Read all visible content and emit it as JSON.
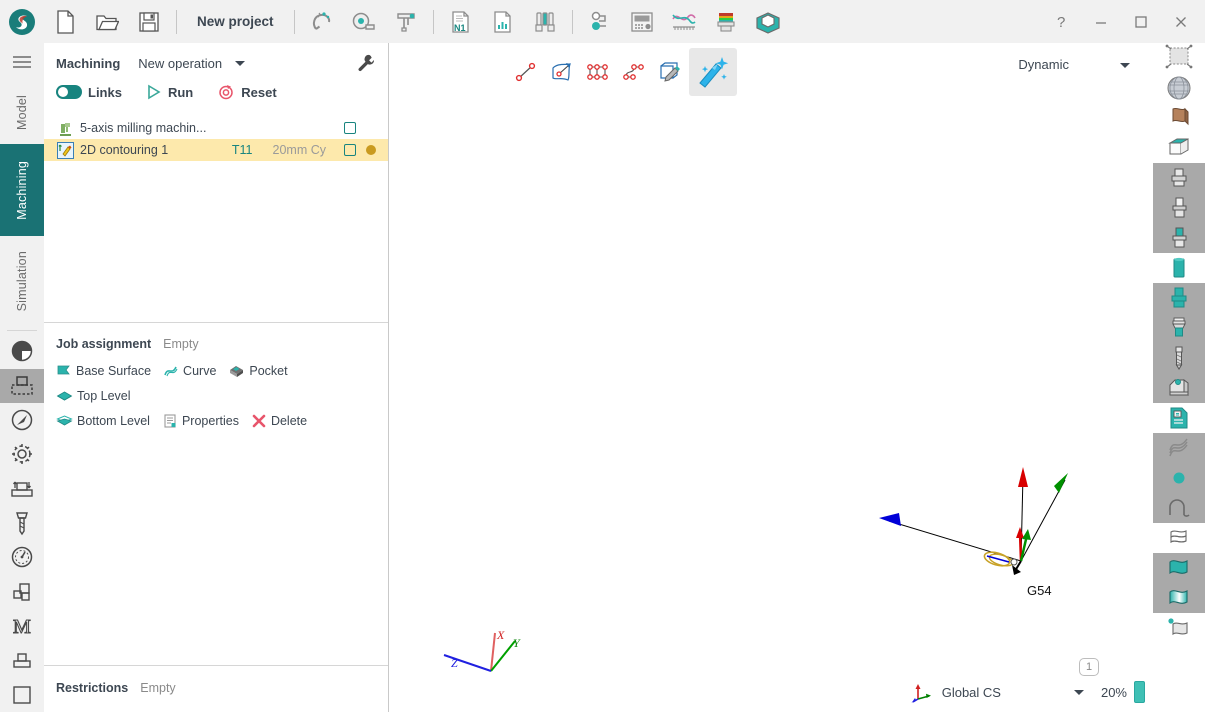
{
  "window": {
    "title": "New project",
    "controls": [
      {
        "name": "help-button",
        "glyph": "?"
      },
      {
        "name": "minimize-button",
        "glyph": "—"
      },
      {
        "name": "maximize-button",
        "glyph": "□"
      },
      {
        "name": "close-button",
        "glyph": "✕"
      }
    ]
  },
  "toolbar": {
    "file_icons": [
      "new-document-icon",
      "open-folder-icon",
      "save-disk-icon"
    ],
    "tool_icons": [
      "magnet-icon",
      "measure-tape-icon",
      "caliper-icon",
      "nc-program-icon",
      "report-chart-icon",
      "tool-library-icon",
      "post-processor-icon",
      "control-panel-icon",
      "feed-curve-icon",
      "stock-color-icon",
      "fixture-box-icon"
    ]
  },
  "rail": {
    "menu_icon": "hamburger-icon",
    "tabs": [
      {
        "label": "Model",
        "active": false
      },
      {
        "label": "Machining",
        "active": true
      },
      {
        "label": "Simulation",
        "active": false
      }
    ],
    "icons": [
      {
        "name": "shading-sphere-icon",
        "selected": false
      },
      {
        "name": "stock-workpiece-icon",
        "selected": true
      },
      {
        "name": "compass-orientation-icon",
        "selected": false
      },
      {
        "name": "settings-gear-icon",
        "selected": false
      },
      {
        "name": "clearance-levels-icon",
        "selected": false
      },
      {
        "name": "end-mill-tool-icon",
        "selected": false
      },
      {
        "name": "speed-gauge-icon",
        "selected": false
      },
      {
        "name": "layers-stack-icon",
        "selected": false
      },
      {
        "name": "machine-m-icon",
        "selected": false
      },
      {
        "name": "fixture-base-icon",
        "selected": false
      },
      {
        "name": "blank-square-icon",
        "selected": false
      }
    ]
  },
  "machining": {
    "title": "Machining",
    "new_operation_label": "New operation",
    "wrench_icon": "wrench-settings-icon",
    "actions": [
      {
        "name": "links-toggle",
        "label": "Links",
        "icon": "toggle-switch-on-icon"
      },
      {
        "name": "run-button",
        "label": "Run",
        "icon": "play-triangle-icon"
      },
      {
        "name": "reset-button",
        "label": "Reset",
        "icon": "reset-circle-icon"
      }
    ],
    "tree": [
      {
        "name": "machine-node",
        "icon": "milling-machine-icon",
        "label": "5-axis milling machin...",
        "tool": "",
        "tool_desc": "",
        "checkbox": true,
        "status_dot": false,
        "selected": false
      },
      {
        "name": "operation-node",
        "icon": "contouring-op-icon",
        "label": "2D contouring 1",
        "tool": "T11",
        "tool_desc": "20mm Cy",
        "checkbox": true,
        "status_dot": true,
        "selected": true
      }
    ]
  },
  "job_assignment": {
    "title": "Job assignment",
    "value": "Empty",
    "chips": [
      {
        "name": "base-surface-chip",
        "label": "Base Surface",
        "icon": "flag-teal-icon"
      },
      {
        "name": "curve-chip",
        "label": "Curve",
        "icon": "curve-squiggle-icon"
      },
      {
        "name": "pocket-chip",
        "label": "Pocket",
        "icon": "pocket-box-icon"
      },
      {
        "name": "top-level-chip",
        "label": "Top Level",
        "icon": "top-level-diamond-icon"
      },
      {
        "name": "bottom-level-chip",
        "label": "Bottom Level",
        "icon": "bottom-level-diamond-icon"
      },
      {
        "name": "properties-chip",
        "label": "Properties",
        "icon": "properties-list-icon"
      },
      {
        "name": "delete-chip",
        "label": "Delete",
        "icon": "delete-cross-icon"
      }
    ]
  },
  "restrictions": {
    "title": "Restrictions",
    "value": "Empty"
  },
  "viewport": {
    "tools": [
      {
        "name": "line-segment-tool",
        "active": false
      },
      {
        "name": "surface-pick-tool",
        "active": false
      },
      {
        "name": "polyline-tool",
        "active": false
      },
      {
        "name": "spline-tool",
        "active": false
      },
      {
        "name": "edit-geometry-tool",
        "active": false
      },
      {
        "name": "magic-wand-tool",
        "active": true
      }
    ],
    "view_mode": "Dynamic",
    "cs_label": "Global CS",
    "zoom": "20%",
    "page_badge": "1",
    "wcs_label": "G54",
    "axis_labels": {
      "x": "X",
      "y": "Y",
      "z": "Z"
    }
  },
  "right_toolbar": [
    {
      "name": "mesh-surface-icon",
      "gray": false
    },
    {
      "name": "globe-sphere-icon",
      "gray": false
    },
    {
      "name": "brown-flag-icon",
      "gray": false
    },
    {
      "name": "bounding-box-icon",
      "gray": false
    },
    {
      "name": "tool-holder-1-icon",
      "gray": true
    },
    {
      "name": "tool-holder-2-icon",
      "gray": true
    },
    {
      "name": "tool-holder-3-icon",
      "gray": true
    },
    {
      "name": "tool-shank-teal-icon",
      "gray": false
    },
    {
      "name": "tool-body-teal-icon",
      "gray": true
    },
    {
      "name": "tool-stack-icon",
      "gray": true
    },
    {
      "name": "drill-bit-icon",
      "gray": true
    },
    {
      "name": "fixture-clamp-icon",
      "gray": true
    },
    {
      "name": "document-teal-icon",
      "gray": false
    },
    {
      "name": "hatch-pattern-icon",
      "gray": true
    },
    {
      "name": "point-dot-icon",
      "gray": true
    },
    {
      "name": "arc-curve-icon",
      "gray": true
    },
    {
      "name": "wireframe-surface-icon",
      "gray": false
    },
    {
      "name": "surface-teal-icon",
      "gray": true
    },
    {
      "name": "surface-gradient-icon",
      "gray": true
    },
    {
      "name": "flag-point-icon",
      "gray": false
    }
  ],
  "colors": {
    "accent_teal": "#1a7274",
    "toggle_green": "#18847f",
    "selection_amber": "#fde9ac",
    "panel_bg": "#f1f1f1",
    "text_dark": "#3d4752",
    "text_muted": "#9a9a9a"
  }
}
